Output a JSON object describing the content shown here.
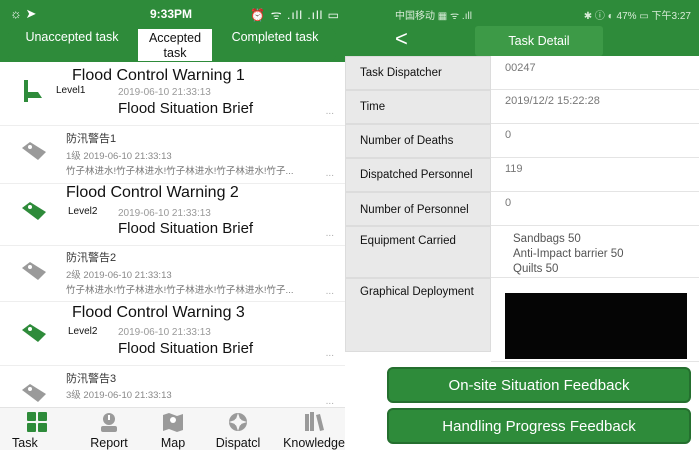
{
  "left_phone": {
    "status_bar": {
      "time": "9:33PM",
      "left_icons": "☼ ➤",
      "right_icons": "⏰ ᯤ .ıll .ıll ▭"
    },
    "tabs": [
      {
        "label": "Unaccepted task"
      },
      {
        "label": "Accepted task"
      },
      {
        "label": "Completed task"
      }
    ],
    "items": [
      {
        "title": "Flood Control Warning 1",
        "level": "Level1",
        "date": "2019-06-10 21:33:13",
        "brief": "Flood Situation Brief",
        "more": "..."
      },
      {
        "title": "防汛警告1",
        "meta": "1级     2019-06-10 21:33:13",
        "body": "竹子林进水!竹子林进水!竹子林进水!竹子林进水!竹子...",
        "more": "..."
      },
      {
        "title": "Flood Control Warning 2",
        "level": "Level2",
        "date": "2019-06-10 21:33:13",
        "brief": "Flood Situation Brief",
        "more": "..."
      },
      {
        "title": "防汛警告2",
        "meta": "2级     2019-06-10 21:33:13",
        "body": "竹子林进水!竹子林进水!竹子林进水!竹子林进水!竹子...",
        "more": "..."
      },
      {
        "title": "Flood Control Warning 3",
        "level": "Level2",
        "date": "2019-06-10 21:33:13",
        "brief": "Flood Situation Brief",
        "more": "..."
      },
      {
        "title": "防汛警告3",
        "meta": "3级     2019-06-10 21:33:13",
        "more": "..."
      }
    ],
    "nav": [
      {
        "label": "Task",
        "icon": "task-grid-icon"
      },
      {
        "label": "Report",
        "icon": "report-icon"
      },
      {
        "label": "Map",
        "icon": "map-icon"
      },
      {
        "label": "Dispatcl",
        "icon": "dispatch-icon"
      },
      {
        "label": "Knowledge",
        "icon": "knowledge-books-icon"
      }
    ],
    "colors": {
      "primary": "#2e8b3a",
      "tag_active": "#2e8b3a",
      "tag_inactive": "#9a9a9a"
    }
  },
  "right_phone": {
    "status_bar": {
      "left": "中国移动 ▦ ᯤ .ıll",
      "right": "✱ ⓘ ◐ 47% ▭ 下午3:27"
    },
    "back": "<",
    "title": "Task Detail",
    "rows": [
      {
        "label": "Task Dispatcher",
        "value": "00247"
      },
      {
        "label": "Time",
        "value": "2019/12/2 15:22:28"
      },
      {
        "label": "Number of Deaths",
        "value": "0"
      },
      {
        "label": "Dispatched Personnel",
        "value": "119"
      },
      {
        "label": "Number of Personnel",
        "value": "0"
      },
      {
        "label": "Equipment Carried"
      },
      {
        "label": "Graphical Deployment"
      }
    ],
    "equipment": [
      "Sandbags 50",
      "Anti-Impact barrier 50",
      "Quilts 50"
    ],
    "buttons": {
      "onsite_feedback": "On-site Situation Feedback",
      "progress_feedback": "Handling Progress Feedback"
    }
  }
}
